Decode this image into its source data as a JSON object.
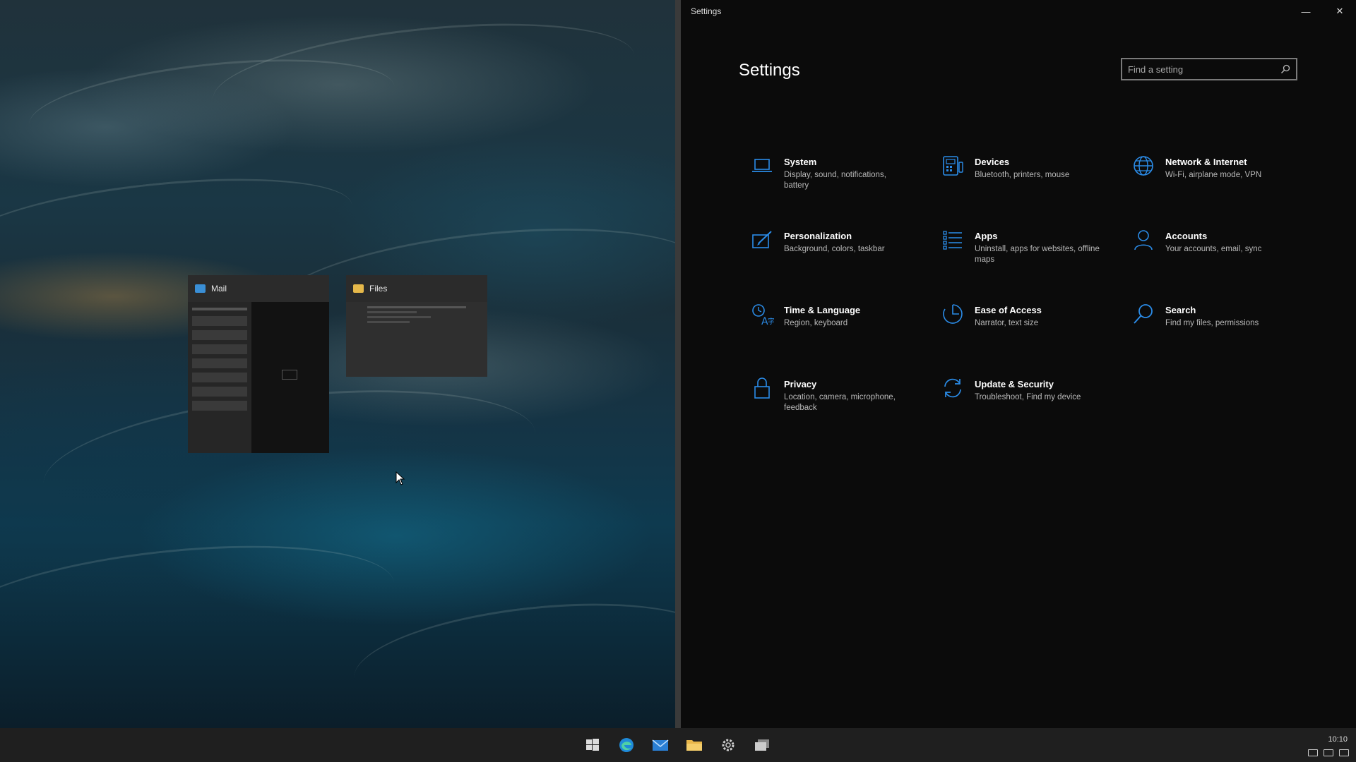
{
  "window": {
    "title": "Settings",
    "minimize_glyph": "—",
    "close_glyph": "✕"
  },
  "settings": {
    "title": "Settings",
    "search_placeholder": "Find a setting",
    "categories": [
      {
        "name": "System",
        "desc": "Display, sound, notifications, battery",
        "icon": "laptop-icon"
      },
      {
        "name": "Devices",
        "desc": "Bluetooth, printers, mouse",
        "icon": "devices-icon"
      },
      {
        "name": "Network & Internet",
        "desc": "Wi-Fi, airplane mode, VPN",
        "icon": "globe-icon"
      },
      {
        "name": "Personalization",
        "desc": "Background, colors, taskbar",
        "icon": "paintbrush-icon"
      },
      {
        "name": "Apps",
        "desc": "Uninstall, apps for websites, offline maps",
        "icon": "apps-list-icon"
      },
      {
        "name": "Accounts",
        "desc": "Your accounts, email, sync",
        "icon": "person-icon"
      },
      {
        "name": "Time & Language",
        "desc": "Region, keyboard",
        "icon": "time-language-icon"
      },
      {
        "name": "Ease of Access",
        "desc": "Narrator, text size",
        "icon": "ease-of-access-icon"
      },
      {
        "name": "Search",
        "desc": "Find my files, permissions",
        "icon": "search-icon"
      },
      {
        "name": "Privacy",
        "desc": "Location, camera, microphone, feedback",
        "icon": "lock-icon"
      },
      {
        "name": "Update & Security",
        "desc": "Troubleshoot, Find my device",
        "icon": "sync-icon"
      }
    ]
  },
  "snap_assist": {
    "mail_title": "Mail",
    "files_title": "Files"
  },
  "taskbar": {
    "clock": "10:10",
    "icons": [
      "windows-start-icon",
      "edge-browser-icon",
      "mail-app-icon",
      "file-explorer-icon",
      "settings-gear-icon",
      "task-view-icon"
    ]
  },
  "colors": {
    "accent": "#2b8ce8",
    "window_bg": "#0b0b0b",
    "taskbar_bg": "#1f1f1f"
  }
}
